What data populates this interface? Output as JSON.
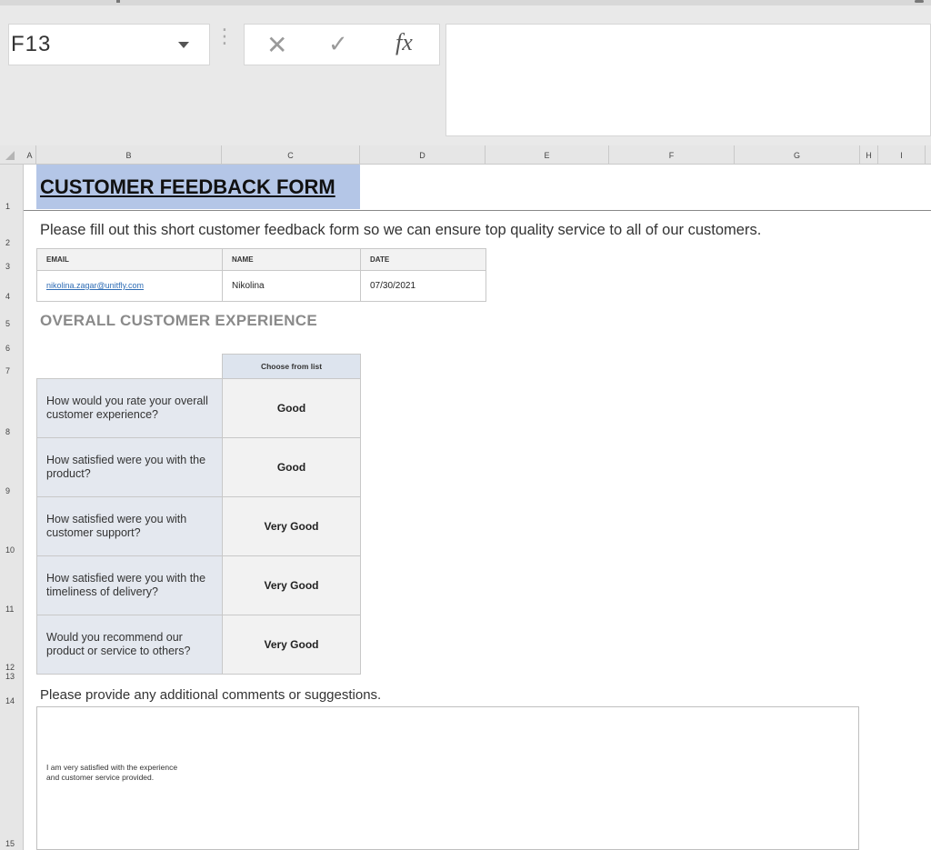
{
  "formula_bar": {
    "name_box": "F13",
    "cancel_icon": "✕",
    "enter_icon": "✓",
    "function_label": "fx",
    "content": ""
  },
  "columns": [
    "A",
    "B",
    "C",
    "D",
    "E",
    "F",
    "G",
    "H",
    "I"
  ],
  "rows": [
    "1",
    "2",
    "3",
    "4",
    "5",
    "6",
    "7",
    "8",
    "9",
    "10",
    "11",
    "12",
    "13",
    "14",
    "15"
  ],
  "form": {
    "title": "CUSTOMER FEEDBACK FORM",
    "intro": "Please fill out this short customer feedback form so we can ensure top quality service to all of our customers.",
    "info_headers": [
      "EMAIL",
      "NAME",
      "DATE"
    ],
    "info_values": {
      "email": "nikolina.zagar@unitfly.com",
      "name": "Nikolina",
      "date": "07/30/2021"
    },
    "section_title": "OVERALL CUSTOMER EXPERIENCE",
    "answer_header": "Choose from list",
    "questions": [
      {
        "q": "How would you rate your overall customer experience?",
        "a": "Good"
      },
      {
        "q": "How satisfied were you with the product?",
        "a": "Good"
      },
      {
        "q": "How satisfied were you with customer support?",
        "a": "Very Good"
      },
      {
        "q": "How satisfied were you with the timeliness of delivery?",
        "a": "Very Good"
      },
      {
        "q": "Would you recommend our product or service to others?",
        "a": "Very Good"
      }
    ],
    "comments_label": "Please provide any additional comments or suggestions.",
    "comments_text": "I am very satisfied with the experience and customer service provided."
  },
  "colors": {
    "title_fill": "#b4c6e7",
    "question_fill": "#e4e8ef",
    "answer_header_fill": "#dde4ee",
    "link": "#2f6db5"
  }
}
